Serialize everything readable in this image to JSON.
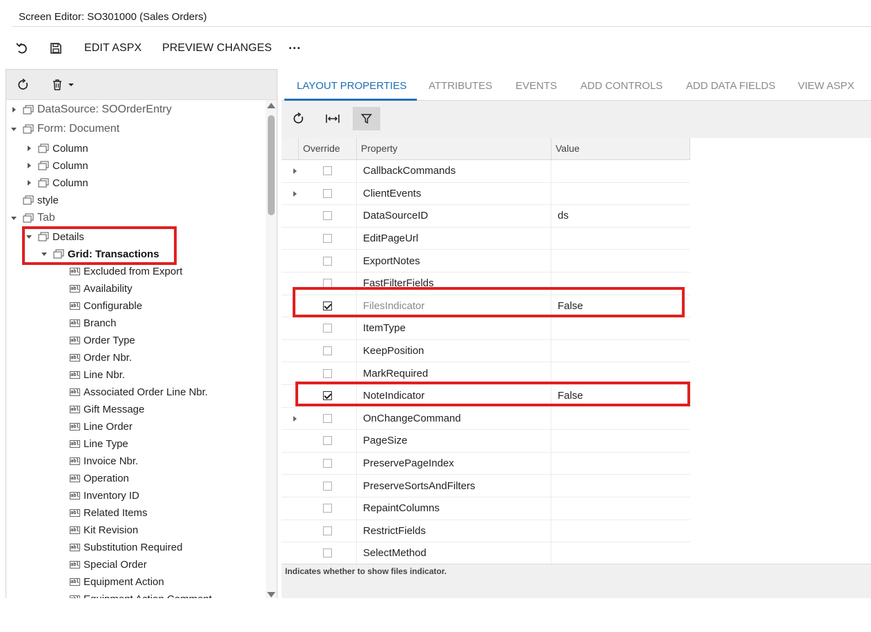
{
  "window": {
    "title": "Screen Editor: SO301000 (Sales Orders)"
  },
  "toolbar": {
    "undo_icon": "undo-icon",
    "save_icon": "save-icon",
    "edit_aspx": "EDIT ASPX",
    "preview_changes": "PREVIEW CHANGES",
    "more": "···"
  },
  "left_toolbar": {
    "refresh_icon": "refresh-icon",
    "delete_icon": "trash-icon",
    "dropdown_icon": "caret-down-icon"
  },
  "tree": {
    "nodes": [
      {
        "label": "DataSource: SOOrderEntry"
      },
      {
        "label": "Form: Document"
      },
      {
        "label": "Column"
      },
      {
        "label": "Column"
      },
      {
        "label": "Column"
      },
      {
        "label": "style"
      },
      {
        "label": "Tab"
      },
      {
        "label": "Details"
      },
      {
        "label": "Grid: Transactions"
      }
    ],
    "fields": [
      "Excluded from Export",
      "Availability",
      "Configurable",
      "Branch",
      "Order Type",
      "Order Nbr.",
      "Line Nbr.",
      "Associated Order Line Nbr.",
      "Gift Message",
      "Line Order",
      "Line Type",
      "Invoice Nbr.",
      "Operation",
      "Inventory ID",
      "Related Items",
      "Kit Revision",
      "Substitution Required",
      "Special Order",
      "Equipment Action",
      "Equipment Action Comment"
    ]
  },
  "tabs": [
    {
      "label": "LAYOUT PROPERTIES",
      "active": true
    },
    {
      "label": "ATTRIBUTES"
    },
    {
      "label": "EVENTS"
    },
    {
      "label": "ADD CONTROLS"
    },
    {
      "label": "ADD DATA FIELDS"
    },
    {
      "label": "VIEW ASPX"
    }
  ],
  "right_toolbar": {
    "refresh_icon": "refresh-icon",
    "fit_columns_icon": "fit-width-icon",
    "filter_icon": "filter-icon"
  },
  "grid": {
    "headers": {
      "override": "Override",
      "property": "Property",
      "value": "Value"
    },
    "rows": [
      {
        "property": "CallbackCommands",
        "value": "",
        "override": false,
        "expandable": true
      },
      {
        "property": "ClientEvents",
        "value": "",
        "override": false,
        "expandable": true
      },
      {
        "property": "DataSourceID",
        "value": "ds",
        "override": false
      },
      {
        "property": "EditPageUrl",
        "value": "",
        "override": false
      },
      {
        "property": "ExportNotes",
        "value": "",
        "override": false
      },
      {
        "property": "FastFilterFields",
        "value": "",
        "override": false
      },
      {
        "property": "FilesIndicator",
        "value": "False",
        "override": true,
        "dim": true
      },
      {
        "property": "ItemType",
        "value": "",
        "override": false
      },
      {
        "property": "KeepPosition",
        "value": "",
        "override": false
      },
      {
        "property": "MarkRequired",
        "value": "",
        "override": false
      },
      {
        "property": "NoteIndicator",
        "value": "False",
        "override": true
      },
      {
        "property": "OnChangeCommand",
        "value": "",
        "override": false,
        "expandable": true
      },
      {
        "property": "PageSize",
        "value": "",
        "override": false
      },
      {
        "property": "PreservePageIndex",
        "value": "",
        "override": false
      },
      {
        "property": "PreserveSortsAndFilters",
        "value": "",
        "override": false
      },
      {
        "property": "RepaintColumns",
        "value": "",
        "override": false
      },
      {
        "property": "RestrictFields",
        "value": "",
        "override": false
      },
      {
        "property": "SelectMethod",
        "value": "",
        "override": false
      }
    ]
  },
  "hint": {
    "text": "Indicates whether to show files indicator."
  },
  "colors": {
    "accent": "#1a6fb8",
    "highlight": "#e02020"
  }
}
